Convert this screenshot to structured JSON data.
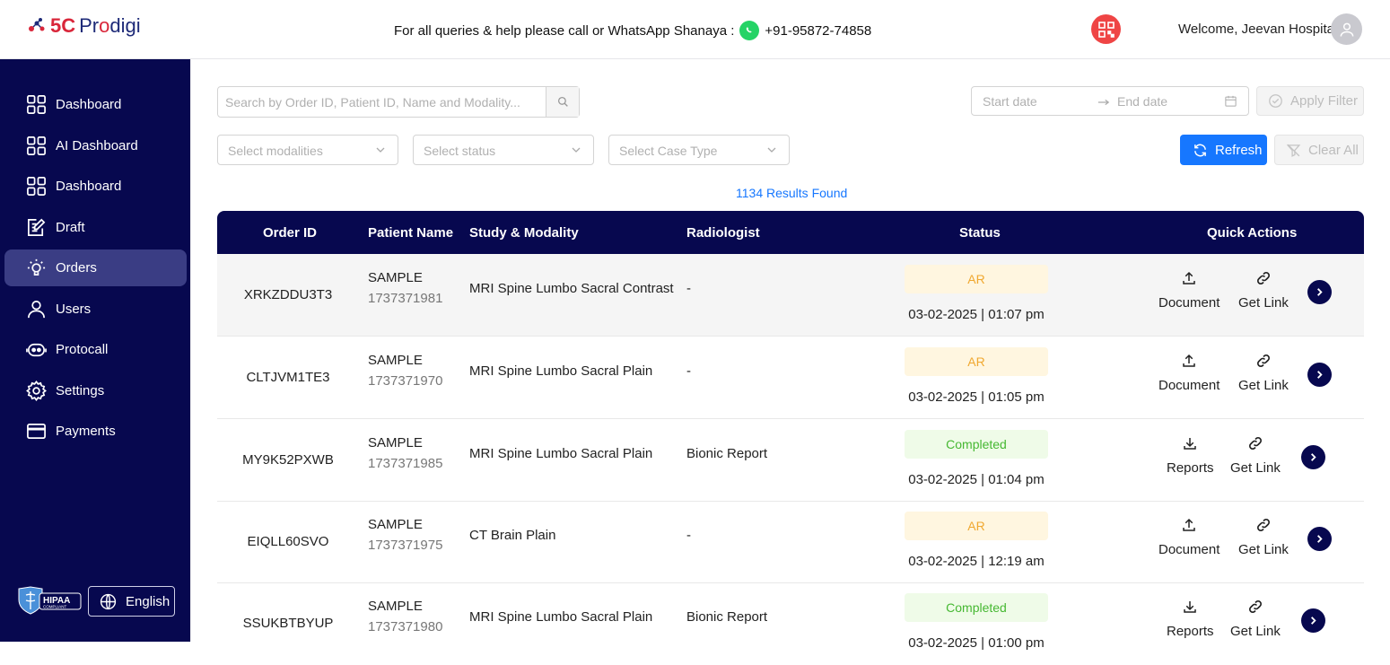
{
  "header": {
    "logo_num": "5C",
    "logo_name_pre": "Pr",
    "logo_name_o": "o",
    "logo_name_post": "digi",
    "help_text": "For all queries & help please call or WhatsApp Shanaya :",
    "phone": "+91-95872-74858",
    "welcome": "Welcome, Jeevan Hospital"
  },
  "sidebar": {
    "items": [
      {
        "label": "Dashboard",
        "icon": "grid-icon"
      },
      {
        "label": "AI Dashboard",
        "icon": "grid-icon"
      },
      {
        "label": "Dashboard",
        "icon": "grid-icon"
      },
      {
        "label": "Draft",
        "icon": "edit-icon"
      },
      {
        "label": "Orders",
        "icon": "bulb-icon"
      },
      {
        "label": "Users",
        "icon": "user-icon"
      },
      {
        "label": "Protocall",
        "icon": "robot-icon"
      },
      {
        "label": "Settings",
        "icon": "gear-icon"
      },
      {
        "label": "Payments",
        "icon": "card-icon"
      }
    ],
    "hipaa_line1": "HIPAA",
    "hipaa_line2": "COMPLIANT",
    "language": "English"
  },
  "filters": {
    "search_placeholder": "Search by Order ID, Patient ID, Name and Modality...",
    "start_date": "Start date",
    "end_date": "End date",
    "apply_filter": "Apply Filter",
    "modalities_placeholder": "Select modalities",
    "status_placeholder": "Select status",
    "case_type_placeholder": "Select Case Type",
    "refresh": "Refresh",
    "clear_all": "Clear All"
  },
  "results_text": "1134 Results Found",
  "table": {
    "columns": [
      "Order ID",
      "Patient Name",
      "Study & Modality",
      "Radiologist",
      "Status",
      "Quick Actions"
    ],
    "rows": [
      {
        "order_id": "XRKZDDU3T3",
        "name": "SAMPLE",
        "patient_id": "1737371981",
        "study": "MRI Spine Lumbo Sacral Contrast",
        "radiologist": "-",
        "status": "AR",
        "date": "03-02-2025 | 01:07 pm",
        "action1": "Document",
        "action2": "Get Link"
      },
      {
        "order_id": "CLTJVM1TE3",
        "name": "SAMPLE",
        "patient_id": "1737371970",
        "study": "MRI Spine Lumbo Sacral Plain",
        "radiologist": "-",
        "status": "AR",
        "date": "03-02-2025 | 01:05 pm",
        "action1": "Document",
        "action2": "Get Link"
      },
      {
        "order_id": "MY9K52PXWB",
        "name": "SAMPLE",
        "patient_id": "1737371985",
        "study": "MRI Spine Lumbo Sacral Plain",
        "radiologist": "Bionic Report",
        "status": "Completed",
        "date": "03-02-2025 | 01:04 pm",
        "action1": "Reports",
        "action2": "Get Link"
      },
      {
        "order_id": "EIQLL60SVO",
        "name": "SAMPLE",
        "patient_id": "1737371975",
        "study": "CT Brain Plain",
        "radiologist": "-",
        "status": "AR",
        "date": "03-02-2025 | 12:19 am",
        "action1": "Document",
        "action2": "Get Link"
      },
      {
        "order_id": "SSUKBTBYUP",
        "name": "SAMPLE",
        "patient_id": "1737371980",
        "study": "MRI Spine Lumbo Sacral Plain",
        "radiologist": "Bionic Report",
        "status": "Completed",
        "date": "03-02-2025 | 01:00 pm",
        "action1": "Reports",
        "action2": "Get Link"
      }
    ]
  },
  "colors": {
    "sidebar_bg": "#07084f",
    "accent": "#1677ff",
    "ar_badge": "#f0a830",
    "completed_badge": "#46b832"
  }
}
